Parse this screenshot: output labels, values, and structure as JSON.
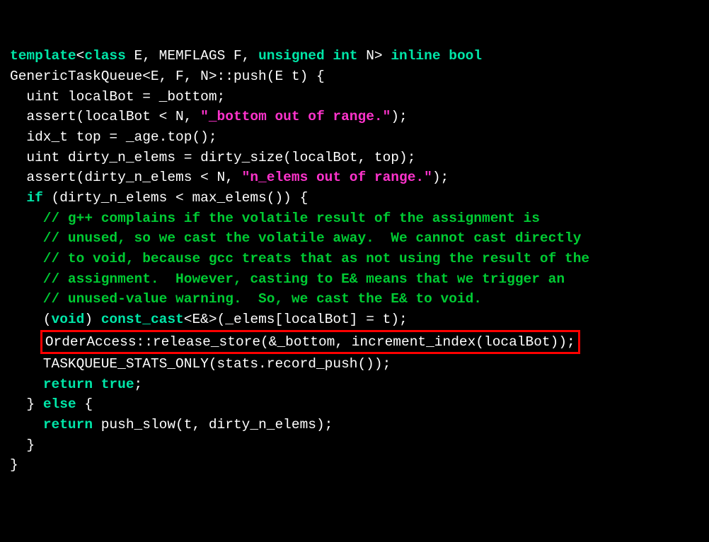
{
  "code": {
    "l1a": "template",
    "l1b": "<",
    "l1c": "class",
    "l1d": " E, MEMFLAGS F, ",
    "l1e": "unsigned",
    "l1f": " ",
    "l1g": "int",
    "l1h": " N> ",
    "l1i": "inline",
    "l1j": " ",
    "l1k": "bool",
    "l2": "GenericTaskQueue<E, F, N>::push(E t) {",
    "l3": "  uint localBot = _bottom;",
    "l4a": "  assert(localBot < N, ",
    "l4b": "\"_bottom out of range.\"",
    "l4c": ");",
    "l5": "  idx_t top = _age.top();",
    "l6": "  uint dirty_n_elems = dirty_size(localBot, top);",
    "l7a": "  assert(dirty_n_elems < N, ",
    "l7b": "\"n_elems out of range.\"",
    "l7c": ");",
    "l8a": "  ",
    "l8b": "if",
    "l8c": " (dirty_n_elems < max_elems()) {",
    "l9": "    // g++ complains if the volatile result of the assignment is",
    "l10": "    // unused, so we cast the volatile away.  We cannot cast directly",
    "l11": "    // to void, because gcc treats that as not using the result of the",
    "l12": "    // assignment.  However, casting to E& means that we trigger an",
    "l13": "    // unused-value warning.  So, we cast the E& to void.",
    "l14a": "    (",
    "l14b": "void",
    "l14c": ") ",
    "l14d": "const_cast",
    "l14e": "<E&>(_elems[localBot] = t);",
    "l15": "OrderAccess::release_store(&_bottom, increment_index(localBot));",
    "l16": "    TASKQUEUE_STATS_ONLY(stats.record_push());",
    "l17a": "    ",
    "l17b": "return",
    "l17c": " ",
    "l17d": "true",
    "l17e": ";",
    "l18a": "  } ",
    "l18b": "else",
    "l18c": " {",
    "l19a": "    ",
    "l19b": "return",
    "l19c": " push_slow(t, dirty_n_elems);",
    "l20": "  }",
    "l21": "}"
  }
}
